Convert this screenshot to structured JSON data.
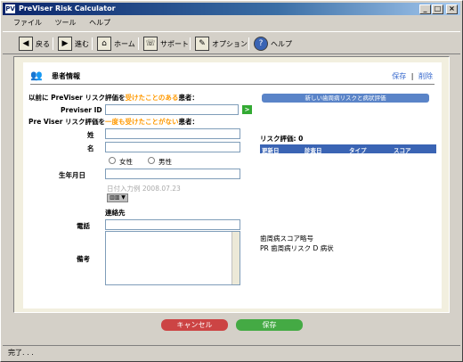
{
  "window": {
    "title": "PreViser Risk Calculator",
    "app_icon": "PV",
    "min": "_",
    "max": "□",
    "close": "×"
  },
  "menu": {
    "file": "ファイル",
    "tools": "ツール",
    "help": "ヘルプ"
  },
  "toolbar": {
    "back": "戻る",
    "forward": "進む",
    "home": "ホーム",
    "support": "サポート",
    "options": "オプション",
    "help": "ヘルプ"
  },
  "header": {
    "title": "患者情報",
    "save_link": "保存",
    "link_sep": "|",
    "delete_link": "削除"
  },
  "form": {
    "existing_prefix": "以前に PreViser リスク評価を",
    "existing_highlight": "受けたことのある",
    "existing_suffix": "患者：",
    "previser_id_label": "Previser ID",
    "go_label": ">",
    "new_prefix": "Pre Viser リスク評価を",
    "new_highlight": "一度も受けたことがない",
    "new_suffix": "患者：",
    "last_name_label": "姓",
    "first_name_label": "名",
    "female_label": "女性",
    "male_label": "男性",
    "dob_label": "生年月日",
    "date_hint": "日付入力例 2008.07.23",
    "contact_label": "連絡先",
    "phone_label": "電話",
    "notes_label": "備考",
    "calendar_icon": "▥▥ ▼"
  },
  "right": {
    "new_eval_button": "新しい歯周病リスクと病状評価",
    "risk_title": "リスク評価: 0",
    "columns": [
      "更新日",
      "診査日",
      "タイプ",
      "スコア"
    ],
    "score_title": "歯周病スコア略号",
    "score_legend": "PR  歯周病リスク    D  病状"
  },
  "buttons": {
    "cancel": "キャンセル",
    "save": "保存"
  },
  "status": "完了. . .",
  "colors": {
    "accent": "#3a64b4",
    "highlight": "#ff9900",
    "cancel": "#cc4444",
    "save": "#44aa44"
  }
}
